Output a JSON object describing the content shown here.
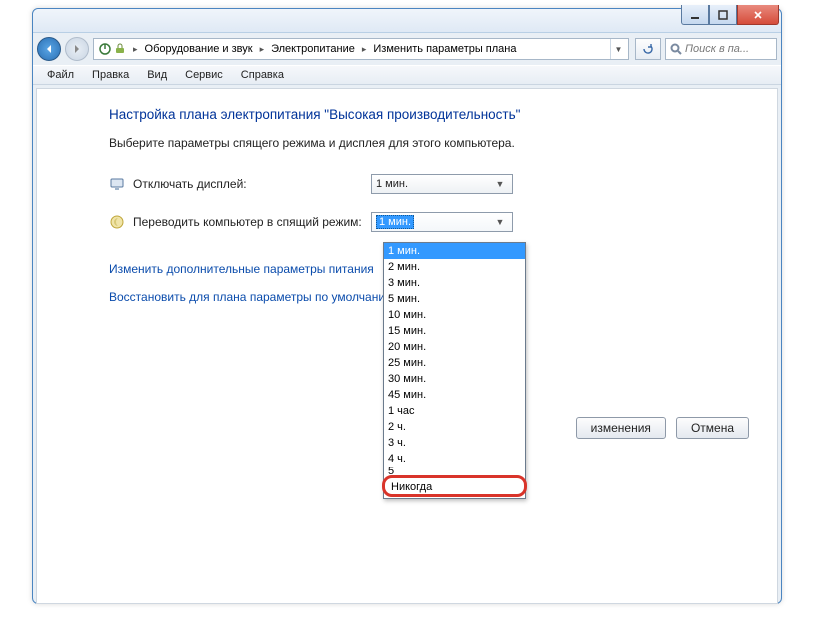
{
  "titlebar": {
    "min": "_",
    "max": "▭",
    "close": "✕"
  },
  "nav": {
    "crumbs": [
      "Оборудование и звук",
      "Электропитание",
      "Изменить параметры плана"
    ],
    "search_placeholder": "Поиск в па..."
  },
  "menu": {
    "file": "Файл",
    "edit": "Правка",
    "view": "Вид",
    "service": "Сервис",
    "help": "Справка"
  },
  "content": {
    "heading": "Настройка плана электропитания \"Высокая производительность\"",
    "sub": "Выберите параметры спящего режима и дисплея для этого компьютера.",
    "row_display": "Отключать дисплей:",
    "row_sleep": "Переводить компьютер в спящий режим:",
    "display_value": "1 мин.",
    "sleep_value": "1 мин.",
    "link_advanced": "Изменить дополнительные параметры питания",
    "link_restore": "Восстановить для плана параметры по умолчани",
    "btn_save": "изменения",
    "btn_cancel": "Отмена"
  },
  "dropdown": {
    "items": [
      "1 мин.",
      "2 мин.",
      "3 мин.",
      "5 мин.",
      "10 мин.",
      "15 мин.",
      "20 мин.",
      "25 мин.",
      "30 мин.",
      "45 мин.",
      "1 час",
      "2 ч.",
      "3 ч.",
      "4 ч."
    ],
    "partial": "5",
    "last": "Никогда"
  }
}
